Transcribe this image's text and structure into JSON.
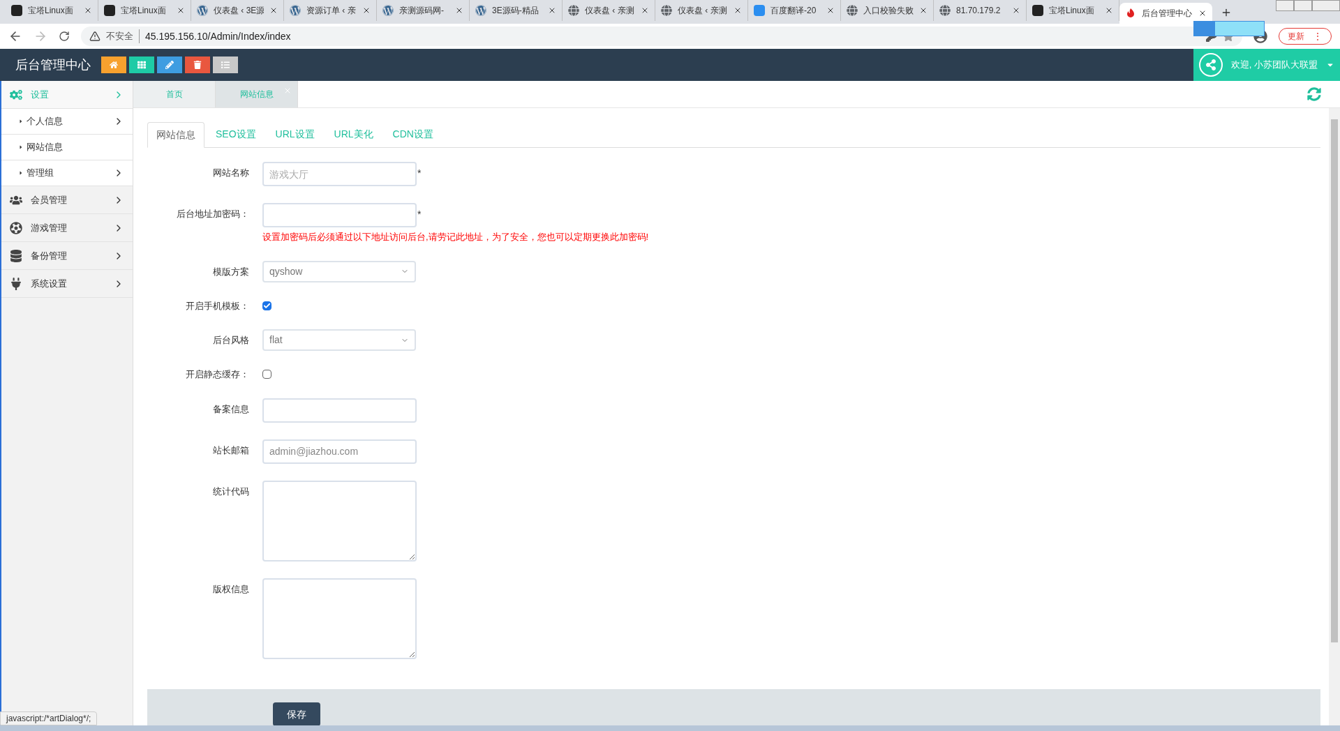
{
  "browser": {
    "tabs": [
      {
        "title": "宝塔Linux面",
        "kind": "bt",
        "selected": false
      },
      {
        "title": "宝塔Linux面",
        "kind": "bt",
        "selected": false
      },
      {
        "title": "仪表盘 ‹ 3E源",
        "kind": "wp",
        "selected": false
      },
      {
        "title": "资源订单 ‹ 亲",
        "kind": "wp",
        "selected": false
      },
      {
        "title": "亲测源码网-",
        "kind": "wp",
        "selected": false
      },
      {
        "title": "3E源码-精品",
        "kind": "wp",
        "selected": false
      },
      {
        "title": "仪表盘 ‹ 亲测",
        "kind": "globe",
        "selected": false
      },
      {
        "title": "仪表盘 ‹ 亲测",
        "kind": "globe",
        "selected": false
      },
      {
        "title": "百度翻译-20",
        "kind": "translate",
        "selected": false
      },
      {
        "title": "入口校验失败",
        "kind": "globe",
        "selected": false
      },
      {
        "title": "81.70.179.2",
        "kind": "globe",
        "selected": false
      },
      {
        "title": "宝塔Linux面",
        "kind": "bt",
        "selected": false
      },
      {
        "title": "后台管理中心",
        "kind": "app",
        "selected": true
      }
    ],
    "security": "不安全",
    "url": "45.195.156.10/Admin/Index/index",
    "update_button": "更新",
    "menu_glyph": "⋮",
    "status_text": "javascript:/*artDialog*/;"
  },
  "header": {
    "title": "后台管理中心",
    "quick_buttons": [
      {
        "kind": "home",
        "color": "#f7a12e"
      },
      {
        "kind": "grid",
        "color": "#1ecba6"
      },
      {
        "kind": "pencil",
        "color": "#3e9de1"
      },
      {
        "kind": "trash",
        "color": "#e9573f"
      },
      {
        "kind": "list",
        "color": "#c8c8c8"
      }
    ],
    "user": "欢迎, 小苏团队大联盟"
  },
  "sidebar": {
    "items": [
      {
        "label": "设置",
        "kind": "gears",
        "expanded": true,
        "children": [
          {
            "label": "个人信息",
            "arrow": true
          },
          {
            "label": "网站信息",
            "arrow": false
          },
          {
            "label": "管理组",
            "arrow": true
          }
        ]
      },
      {
        "label": "会员管理",
        "kind": "users",
        "expanded": false
      },
      {
        "label": "游戏管理",
        "kind": "ball",
        "expanded": false
      },
      {
        "label": "备份管理",
        "kind": "database",
        "expanded": false
      },
      {
        "label": "系统设置",
        "kind": "plug",
        "expanded": false
      }
    ]
  },
  "page_tabs": [
    {
      "label": "首页",
      "selected": false,
      "closable": false
    },
    {
      "label": "网站信息",
      "selected": true,
      "closable": true
    }
  ],
  "form": {
    "tabs": [
      {
        "label": "网站信息",
        "selected": true
      },
      {
        "label": "SEO设置",
        "selected": false
      },
      {
        "label": "URL设置",
        "selected": false
      },
      {
        "label": "URL美化",
        "selected": false
      },
      {
        "label": "CDN设置",
        "selected": false
      }
    ],
    "fields": [
      {
        "kind": "text",
        "label": "网站名称",
        "placeholder": "游戏大厅",
        "required_mark": "*"
      },
      {
        "kind": "text",
        "label": "后台地址加密码：",
        "required_mark": "*",
        "hint": "设置加密码后必须通过以下地址访问后台,请劳记此地址，为了安全，您也可以定期更换此加密码!"
      },
      {
        "kind": "select",
        "label": "模版方案",
        "value": "qyshow"
      },
      {
        "kind": "checkbox",
        "label": "开启手机模板：",
        "checked": true
      },
      {
        "kind": "select",
        "label": "后台风格",
        "value": "flat"
      },
      {
        "kind": "checkbox",
        "label": "开启静态缓存：",
        "checked": false
      },
      {
        "kind": "text",
        "label": "备案信息"
      },
      {
        "kind": "text",
        "label": "站长邮箱",
        "value": "admin@jiazhou.com"
      },
      {
        "kind": "textarea",
        "label": "统计代码"
      },
      {
        "kind": "textarea",
        "label": "版权信息"
      }
    ],
    "save_button": "保存"
  }
}
